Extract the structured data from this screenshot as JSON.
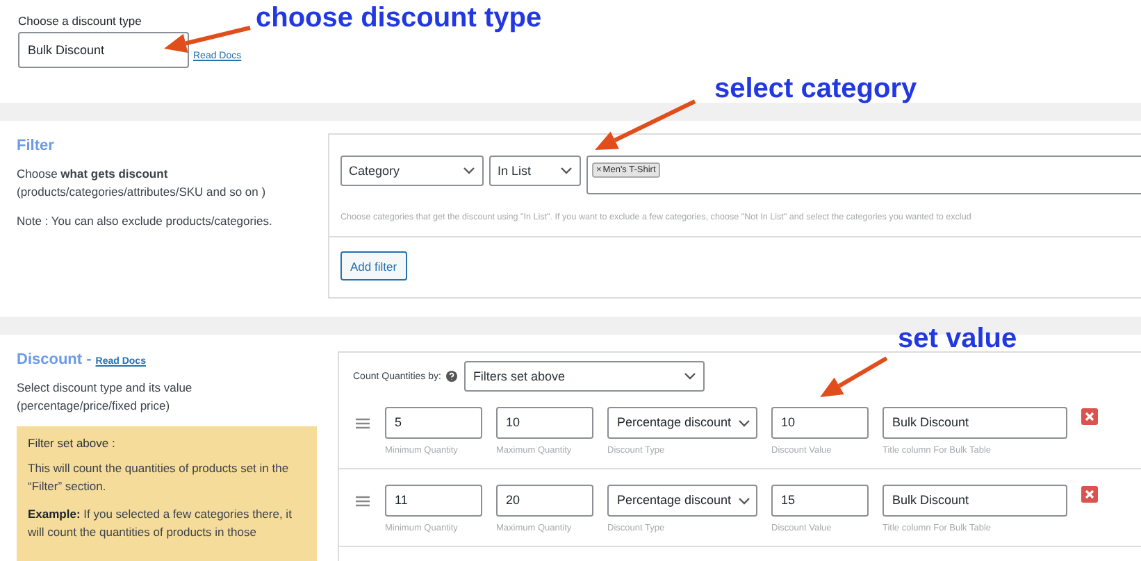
{
  "discount_type": {
    "label": "Choose a discount type",
    "value": "Bulk Discount",
    "link": "Read Docs"
  },
  "annotations": [
    {
      "text": "choose discount type"
    },
    {
      "text": "select category"
    },
    {
      "text": "set value"
    }
  ],
  "filter_section": {
    "title": "Filter",
    "description": "Choose **what gets discount** (products/categories/attributes/SKU and so on )",
    "note": "Note : You can also exclude products/categories.",
    "filters": [
      {
        "type": "Category",
        "operator": "In List",
        "tags": [
          {
            "remove": "×",
            "label": "Men's T-Shirt"
          }
        ]
      }
    ],
    "help": "Choose categories that get the discount using \"In List\". If you want to exclude a few categories, choose \"Not In List\" and select the categories you wanted to exclud",
    "add_button": "Add filter"
  },
  "discount_section": {
    "title": "Discount -",
    "link": "Read Docs",
    "description": "Select discount type and its value (percentage/price/fixed price)",
    "info": {
      "title": "Filter set above :",
      "paragraphs": [
        "This will count the quantities of products set in the “Filter” section.",
        "**Example:** If you selected a few categories there, it will count the quantities of products in those"
      ]
    },
    "count_label": "Count Quantities by:",
    "count_value": "Filters set above",
    "ranges": [
      {
        "fields": [
          {
            "kind": "input",
            "value": "5",
            "label": "Minimum Quantity"
          },
          {
            "kind": "input",
            "value": "10",
            "label": "Maximum Quantity"
          },
          {
            "kind": "select",
            "value": "Percentage discount",
            "label": "Discount Type"
          },
          {
            "kind": "input",
            "value": "10",
            "label": "Discount Value"
          },
          {
            "kind": "title",
            "value": "Bulk Discount",
            "label": "Title column For Bulk Table"
          }
        ]
      },
      {
        "fields": [
          {
            "kind": "input",
            "value": "11",
            "label": "Minimum Quantity"
          },
          {
            "kind": "input",
            "value": "20",
            "label": "Maximum Quantity"
          },
          {
            "kind": "select",
            "value": "Percentage discount",
            "label": "Discount Type"
          },
          {
            "kind": "input",
            "value": "15",
            "label": "Discount Value"
          },
          {
            "kind": "title",
            "value": "Bulk Discount",
            "label": "Title column For Bulk Table"
          }
        ]
      }
    ]
  }
}
